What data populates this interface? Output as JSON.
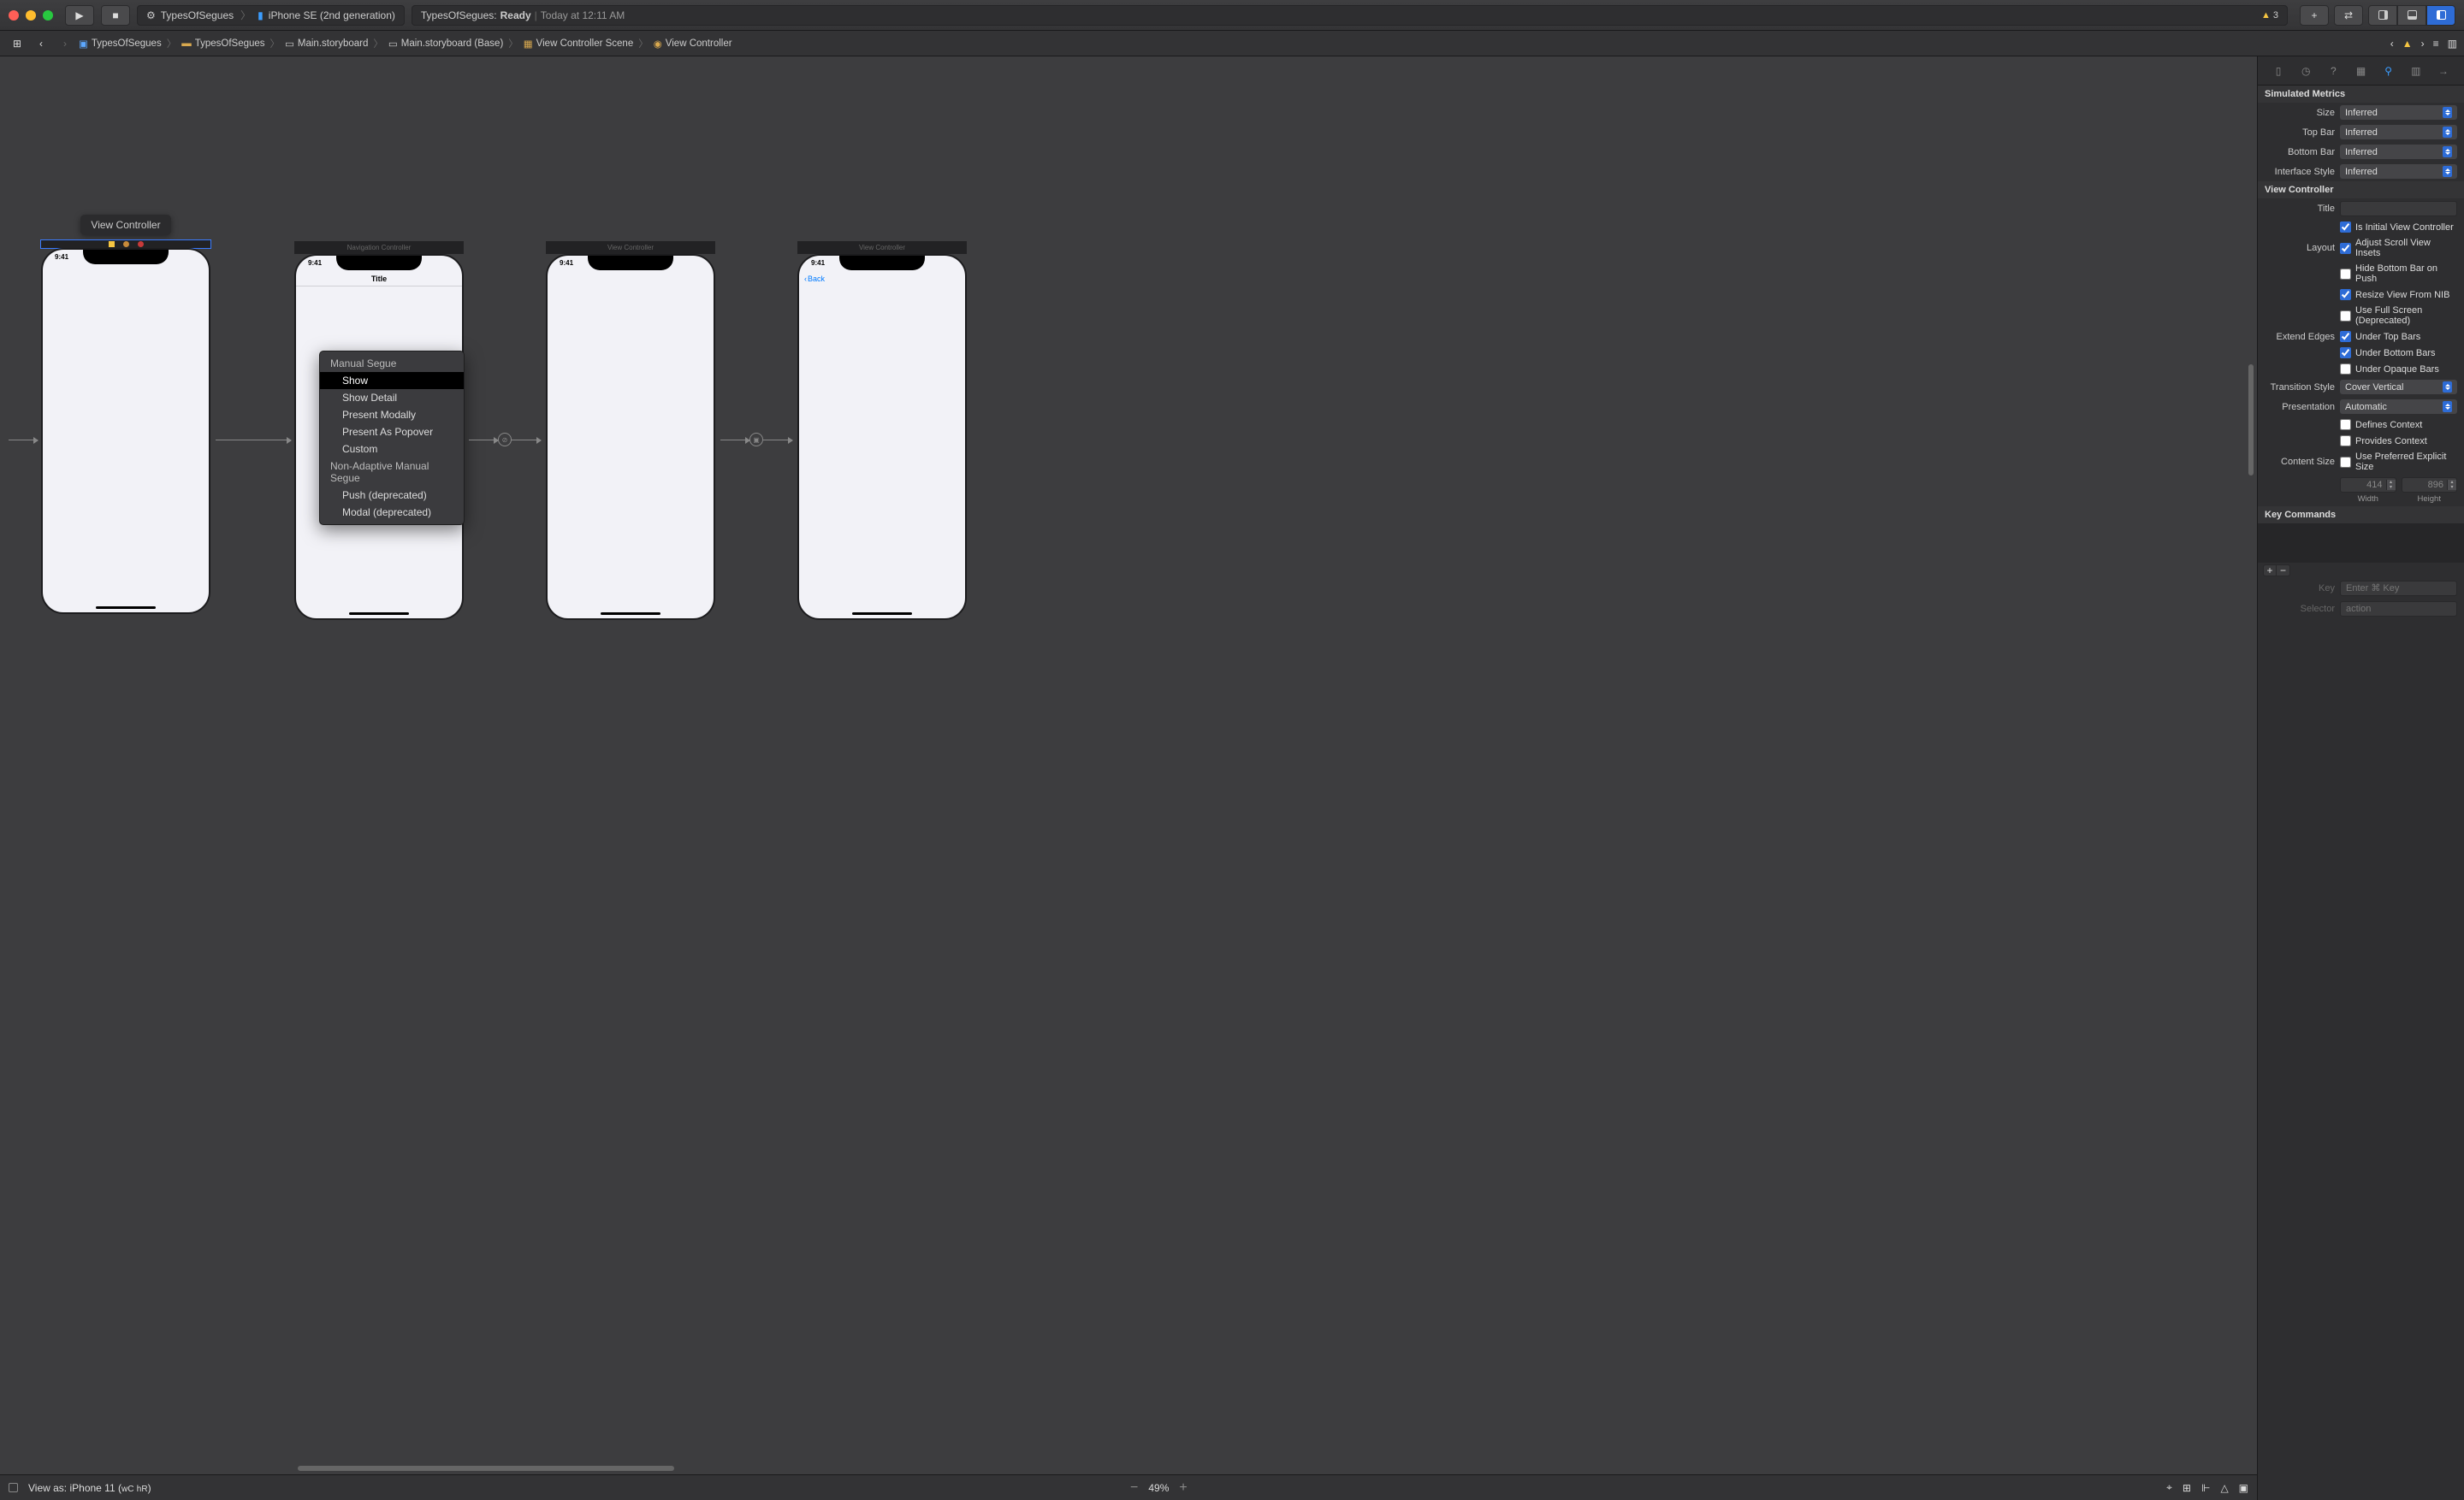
{
  "toolbar": {
    "scheme_project": "TypesOfSegues",
    "scheme_device": "iPhone SE (2nd generation)",
    "status_project": "TypesOfSegues:",
    "status_state": "Ready",
    "status_sep": "|",
    "status_time": "Today at 12:11 AM",
    "warning_count": "3"
  },
  "jumpbar": {
    "crumbs": [
      "TypesOfSegues",
      "TypesOfSegues",
      "Main.storyboard",
      "Main.storyboard (Base)",
      "View Controller Scene",
      "View Controller"
    ]
  },
  "canvas": {
    "tooltip": "View Controller",
    "scenes": [
      {
        "label": "",
        "time": "9:41",
        "nav_title": ""
      },
      {
        "label": "Navigation Controller",
        "time": "9:41",
        "nav_title": "Title"
      },
      {
        "label": "View Controller",
        "time": "9:41",
        "nav_title": ""
      },
      {
        "label": "View Controller",
        "time": "9:41",
        "nav_title": "",
        "back": "Back"
      }
    ],
    "context_menu": {
      "header1": "Manual Segue",
      "items1": [
        "Show",
        "Show Detail",
        "Present Modally",
        "Present As Popover",
        "Custom"
      ],
      "header2": "Non-Adaptive Manual Segue",
      "items2": [
        "Push (deprecated)",
        "Modal (deprecated)"
      ],
      "selected": "Show"
    }
  },
  "inspector": {
    "section_sim": "Simulated Metrics",
    "size_label": "Size",
    "size_val": "Inferred",
    "topbar_label": "Top Bar",
    "topbar_val": "Inferred",
    "botbar_label": "Bottom Bar",
    "botbar_val": "Inferred",
    "ifstyle_label": "Interface Style",
    "ifstyle_val": "Inferred",
    "section_vc": "View Controller",
    "title_label": "Title",
    "title_val": "",
    "initial_label": "Is Initial View Controller",
    "layout_label": "Layout",
    "layout_items": [
      "Adjust Scroll View Insets",
      "Hide Bottom Bar on Push",
      "Resize View From NIB",
      "Use Full Screen (Deprecated)"
    ],
    "extend_label": "Extend Edges",
    "extend_items": [
      "Under Top Bars",
      "Under Bottom Bars",
      "Under Opaque Bars"
    ],
    "trans_label": "Transition Style",
    "trans_val": "Cover Vertical",
    "pres_label": "Presentation",
    "pres_val": "Automatic",
    "defines": "Defines Context",
    "provides": "Provides Context",
    "csize_label": "Content Size",
    "csize_chk": "Use Preferred Explicit Size",
    "width": "414",
    "width_lbl": "Width",
    "height": "896",
    "height_lbl": "Height",
    "section_kc": "Key Commands",
    "key_label": "Key",
    "key_ph": "Enter ⌘ Key",
    "sel_label": "Selector",
    "sel_ph": "action"
  },
  "bottom": {
    "viewas_label": "View as: iPhone 11 (",
    "wc": "wC",
    "hr": "hR",
    "close": ")",
    "zoom": "49%"
  }
}
